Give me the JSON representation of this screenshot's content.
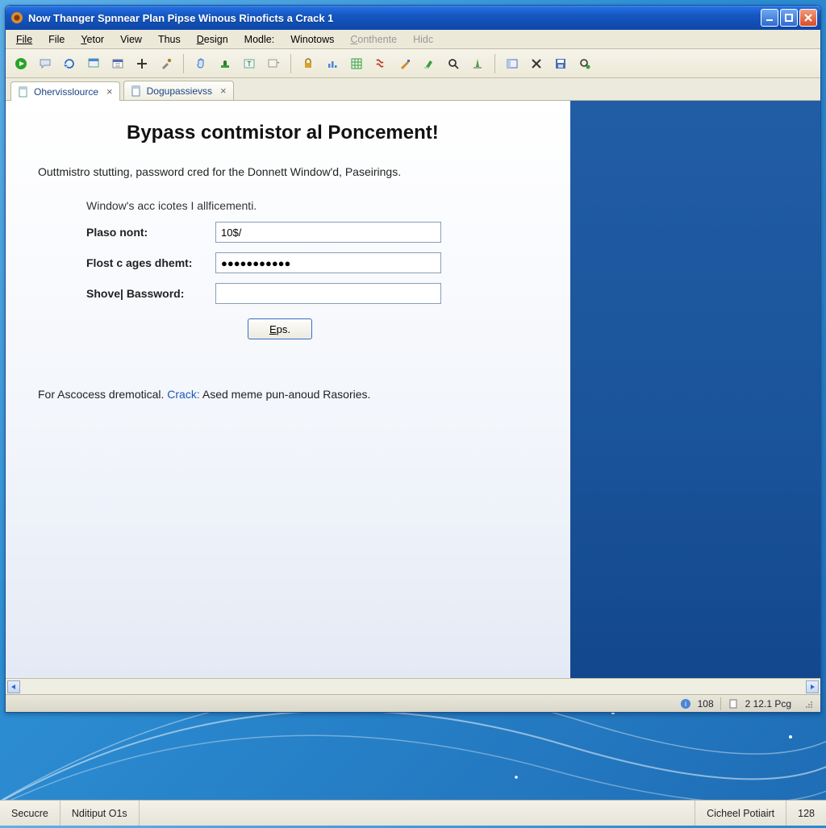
{
  "titlebar": {
    "title": "Now Thanger Spnnear Plan Pipse Winous Rinoficts a Crack 1"
  },
  "menubar": {
    "items": [
      {
        "label": "File",
        "accel": 0,
        "disabled": false
      },
      {
        "label": "File",
        "accel": -1,
        "disabled": false
      },
      {
        "label": "Yetor",
        "accel": 0,
        "disabled": false
      },
      {
        "label": "View",
        "accel": -1,
        "disabled": false
      },
      {
        "label": "Thus",
        "accel": -1,
        "disabled": false
      },
      {
        "label": "Design",
        "accel": 0,
        "disabled": false
      },
      {
        "label": "Modle:",
        "accel": -1,
        "disabled": false
      },
      {
        "label": "Winotows",
        "accel": -1,
        "disabled": false
      },
      {
        "label": "Conthente",
        "accel": 0,
        "disabled": true
      },
      {
        "label": "Hidc",
        "accel": -1,
        "disabled": true
      }
    ]
  },
  "tabs": [
    {
      "label": "Ohervisslource",
      "active": true
    },
    {
      "label": "Dogupassievss",
      "active": false
    }
  ],
  "page": {
    "heading": "Bypass contmistor al Poncement!",
    "intro": "Outtmistro stutting, password cred for the Donnett Window'd, Paseirings.",
    "subheading": "Window's acc icotes I allficementi.",
    "fields": {
      "f1_label": "Plaso nont:",
      "f1_value": "10$/",
      "f2_label": "Flost c ages dhemt:",
      "f2_value": "●●●●●●●●●●●",
      "f3_label": "Shove| Bassword:",
      "f3_value": ""
    },
    "submit_label": "Eps.",
    "footer_pre": "For Ascocess dremotical. ",
    "footer_link": "Crack:",
    "footer_post": " Ased meme pun-anoud Rasories."
  },
  "statusbar": {
    "zoom": "108",
    "page_info": "2 12.1 Pcg"
  },
  "taskbar": {
    "c1": "Secucre",
    "c2": "Nditiput O1s",
    "c3": "Cicheel Potiairt",
    "c4": "128"
  },
  "toolbar_icons": [
    "play-icon",
    "chat-icon",
    "refresh-icon",
    "window-icon",
    "calendar-icon",
    "plus-icon",
    "tool-icon",
    "hand-icon",
    "stamp-icon",
    "text-icon",
    "dropdown-icon",
    "lock-icon",
    "chart-icon",
    "grid-icon",
    "script-icon",
    "draw-icon",
    "marker-icon",
    "search-icon",
    "measure-icon",
    "panel-icon",
    "delete-icon",
    "save-icon",
    "target-icon"
  ],
  "icon_colors": {
    "play": "#28a428",
    "close_red": "#d64d2a",
    "blue": "#2d6ad1",
    "lock": "#d6a22b",
    "marker": "#3a9e3a",
    "script": "#c23a2a"
  }
}
